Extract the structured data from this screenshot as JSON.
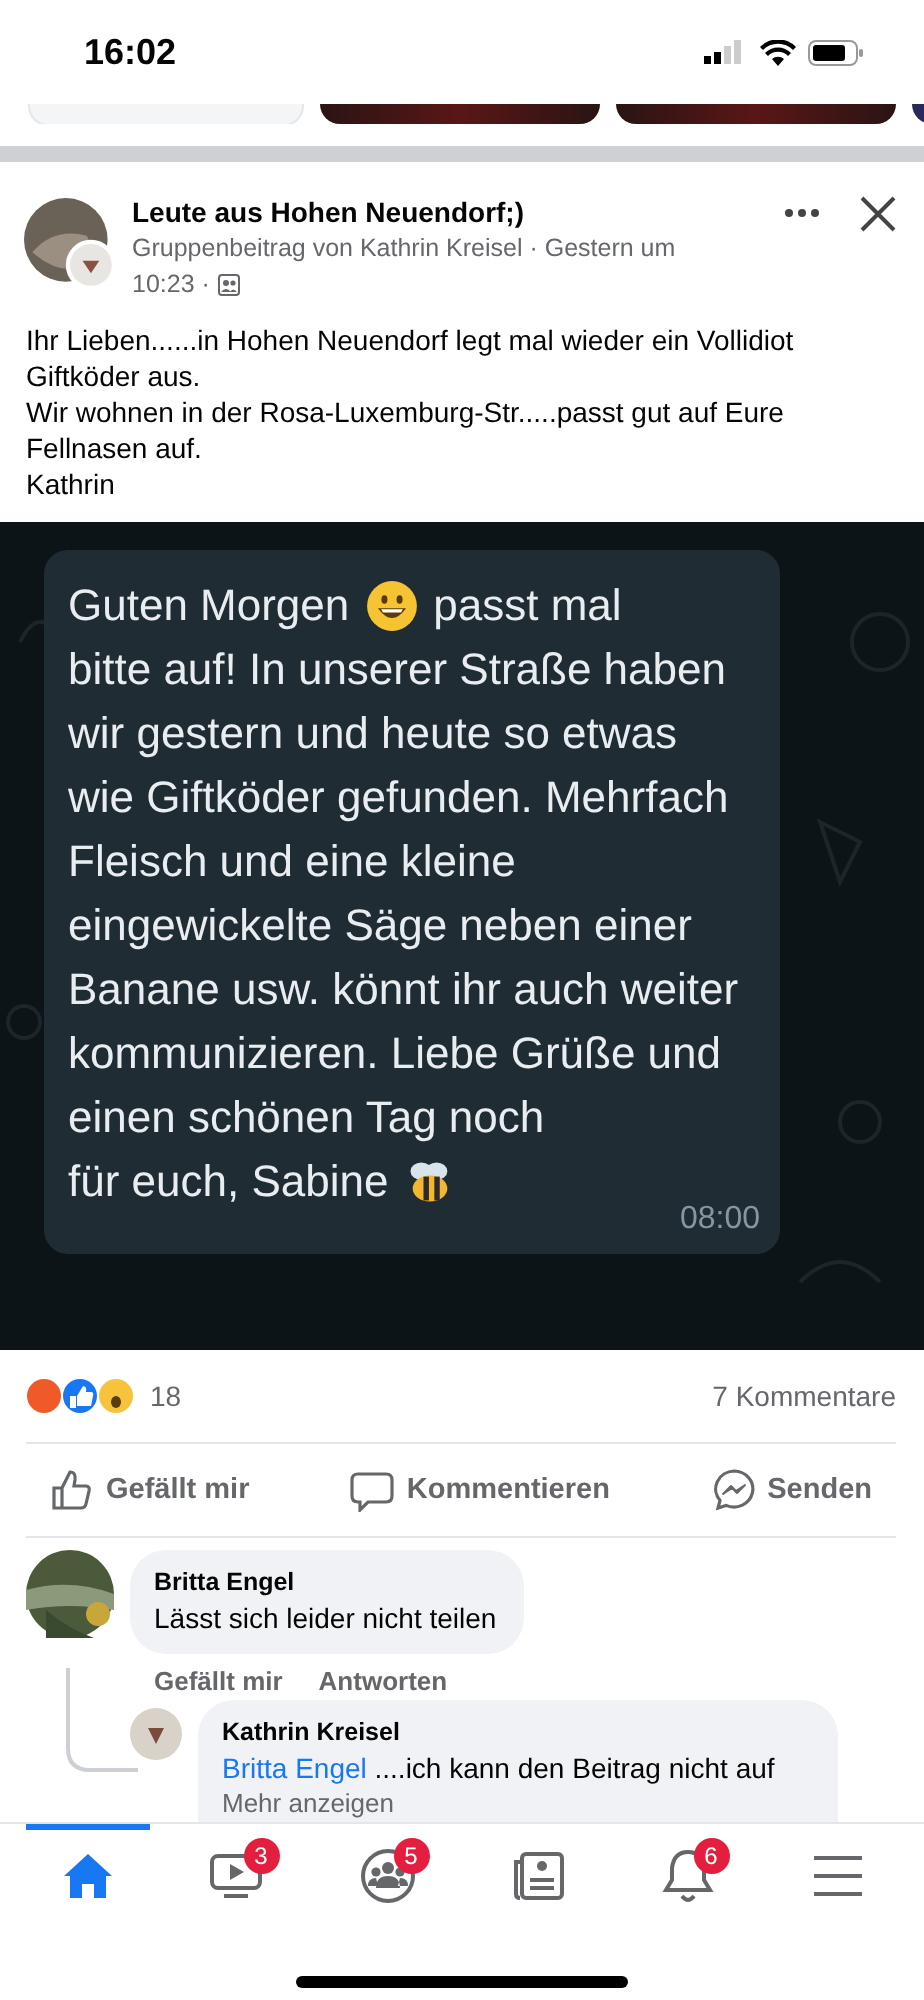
{
  "status_bar": {
    "time": "16:02"
  },
  "post": {
    "group": "Leute aus Hohen Neuendorf;)",
    "meta": "Gruppenbeitrag von Kathrin Kreisel · Gestern um",
    "meta_time": "10:23 ·",
    "paragraphs": [
      "Ihr Lieben......in Hohen Neuendorf legt mal wieder ein Vollidiot Giftköder aus.",
      "Wir wohnen in der Rosa-Luxemburg-Str.....passt gut auf Eure Fellnasen auf.",
      "Kathrin"
    ],
    "message": {
      "text_before": "Guten Morgen",
      "text_after": "passt mal",
      "body": "bitte auf! In unserer Straße haben wir gestern und heute so etwas wie Giftköder gefunden. Mehrfach Fleisch und eine kleine eingewickelte Säge neben einer Banane usw. könnt ihr auch weiter kommunizieren. Liebe Grüße und einen schönen Tag noch",
      "last_line": "für euch, Sabine",
      "time": "08:00"
    },
    "reaction_count": "18",
    "comment_count": "7 Kommentare",
    "actions": [
      {
        "kind": "like",
        "label": "Gefällt mir"
      },
      {
        "kind": "comment",
        "label": "Kommentieren"
      },
      {
        "kind": "send",
        "label": "Senden"
      }
    ]
  },
  "comments": [
    {
      "author": "Britta Engel",
      "text": "Lässt sich leider nicht teilen",
      "links": [
        "Gefällt mir",
        "Antworten"
      ]
    }
  ],
  "reply": {
    "author": "Kathrin Kreisel",
    "mention": "Britta Engel",
    "text": "....ich kann den Beitrag nicht auf",
    "more": "Mehr anzeigen"
  },
  "nav": [
    {
      "kind": "home",
      "selected": true
    },
    {
      "kind": "video",
      "selected": false,
      "badge": "3"
    },
    {
      "kind": "groups",
      "selected": false,
      "badge": "5"
    },
    {
      "kind": "news",
      "selected": false
    },
    {
      "kind": "bell",
      "selected": false,
      "badge": "6"
    },
    {
      "kind": "menu",
      "selected": false
    }
  ]
}
